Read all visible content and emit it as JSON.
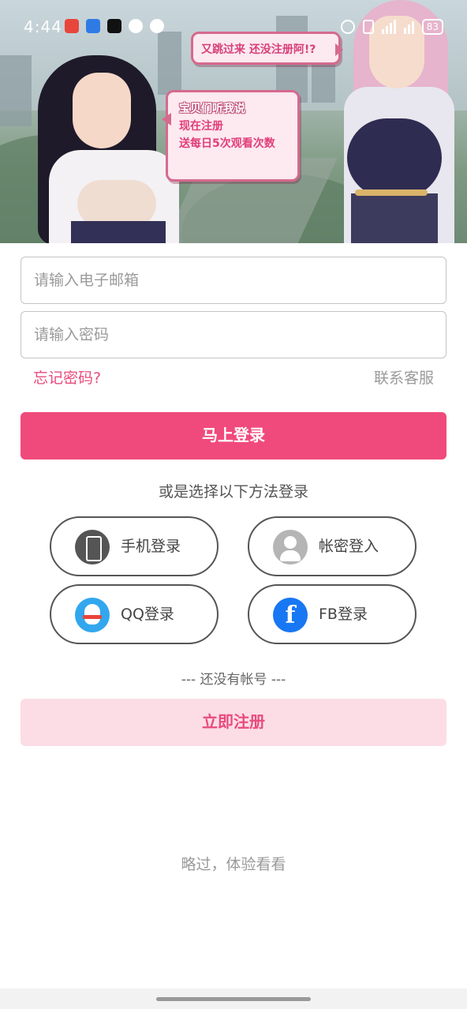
{
  "status_bar": {
    "time": "4:44",
    "battery": "83"
  },
  "banner": {
    "bubble_top": "又跳过来 还没注册阿!?",
    "bubble_mid": {
      "line1": "宝贝们听我说",
      "line2": "现在注册",
      "line3": "送每日5次观看次数"
    }
  },
  "form": {
    "email_placeholder": "请输入电子邮箱",
    "password_placeholder": "请输入密码",
    "forgot_password": "忘记密码?",
    "contact_support": "联系客服",
    "login_button": "马上登录"
  },
  "alternative": {
    "caption": "或是选择以下方法登录",
    "methods": [
      {
        "label": "手机登录",
        "icon": "phone-icon"
      },
      {
        "label": "帐密登入",
        "icon": "user-icon"
      },
      {
        "label": "QQ登录",
        "icon": "qq-icon"
      },
      {
        "label": "FB登录",
        "icon": "facebook-icon"
      }
    ]
  },
  "register": {
    "no_account_text": "--- 还没有帐号 ---",
    "button": "立即注册"
  },
  "skip_text": "略过，体验看看",
  "colors": {
    "primary": "#f04a7c",
    "register_bg": "#fcdde5",
    "link_pink": "#e84b7d",
    "qq_blue": "#32a7ee",
    "facebook_blue": "#1877f2"
  }
}
